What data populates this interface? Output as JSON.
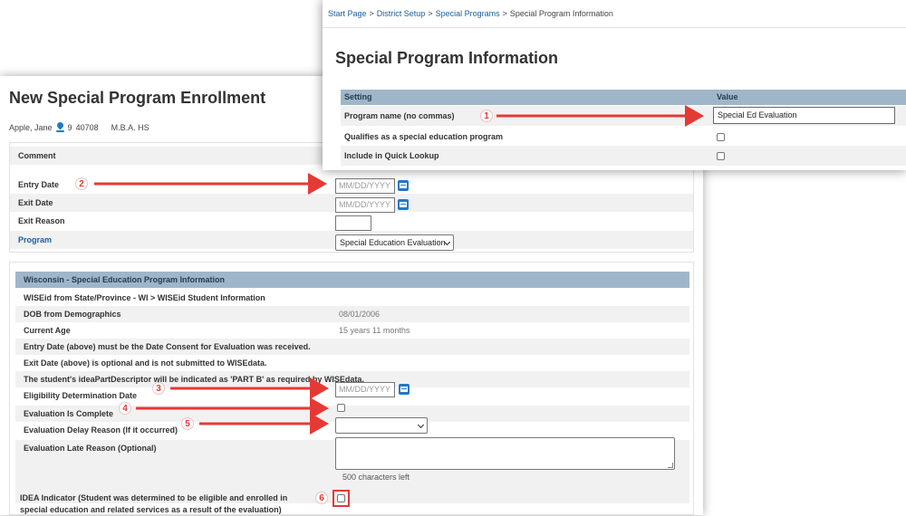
{
  "colors": {
    "accent": "#1e79c9",
    "header_band": "#9fb6c9",
    "annotation_red": "#e53935",
    "link": "#1a5fa0"
  },
  "enrollment": {
    "title": "New Special Program Enrollment",
    "person": {
      "name": "Apple, Jane",
      "grade": "9",
      "id": "40708",
      "school": "M.B.A. HS"
    },
    "rows": {
      "comment": "Comment",
      "entry_date": "Entry Date",
      "exit_date": "Exit Date",
      "exit_reason": "Exit Reason",
      "program": "Program"
    },
    "date_placeholder": "MM/DD/YYYY",
    "program_selected": "Special Education Evaluation",
    "wisconsin": {
      "header": "Wisconsin - Special Education Program Information",
      "wiseid": "WISEid from State/Province - WI > WISEid Student Information",
      "dob_label": "DOB from Demographics",
      "dob_value": "08/01/2006",
      "age_label": "Current Age",
      "age_value": "15 years 11 months",
      "note_entry": "Entry Date (above) must be the Date Consent for Evaluation was received.",
      "note_exit": "Exit Date (above) is optional and is not submitted to WISEdata.",
      "note_idea": "The student's ideaPartDescriptor will be indicated as 'PART B' as required by WISEdata.",
      "elig_label": "Eligibility Determination Date",
      "eval_complete_label": "Evaluation Is Complete",
      "delay_label": "Evaluation Delay Reason (If it occurred)",
      "late_label": "Evaluation Late Reason (Optional)",
      "chars_left": "500 characters left",
      "idea_label": "IDEA Indicator (Student was determined to be eligible and enrolled in special education and related services as a result of the evaluation)"
    }
  },
  "program_info": {
    "breadcrumb": [
      "Start Page",
      "District Setup",
      "Special Programs",
      "Special Program Information"
    ],
    "breadcrumb_sep": ">",
    "title": "Special Program Information",
    "col_setting": "Setting",
    "col_value": "Value",
    "program_name_label": "Program name (no commas)",
    "program_name_value": "Special Ed Evaluation",
    "qualifies_label": "Qualifies as a special education program",
    "quick_lookup_label": "Include in Quick Lookup"
  },
  "annotations": [
    "1",
    "2",
    "3",
    "4",
    "5",
    "6"
  ]
}
